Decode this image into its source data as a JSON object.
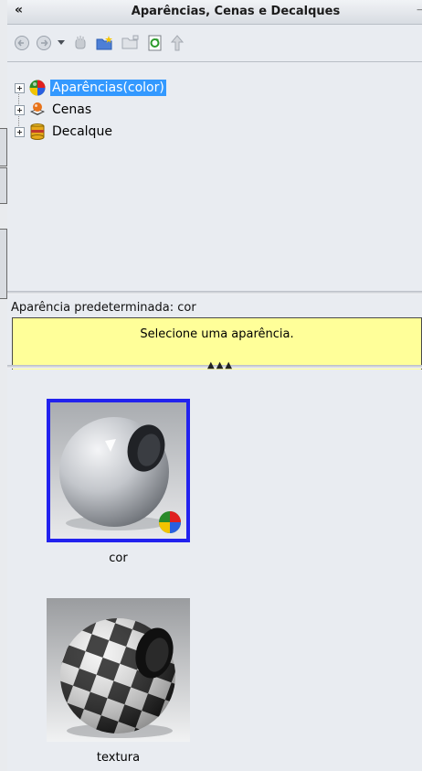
{
  "panel": {
    "title": "Aparências, Cenas e Decalques",
    "collapse_glyph": "«",
    "pin_glyph": "⊣"
  },
  "toolbar": {
    "buttons": [
      "back-icon",
      "forward-icon",
      "dropdown-arrow-icon",
      "hand-icon",
      "new-folder-icon",
      "folder-icon",
      "refresh-icon",
      "up-arrow-icon"
    ]
  },
  "tree": {
    "items": [
      {
        "label": "Aparências(color)",
        "icon": "appearances-icon",
        "selected": true
      },
      {
        "label": "Cenas",
        "icon": "scenes-icon",
        "selected": false
      },
      {
        "label": "Decalque",
        "icon": "decals-icon",
        "selected": false
      }
    ]
  },
  "preview": {
    "default_label": "Aparência predeterminada: cor",
    "hint": "Selecione uma aparência."
  },
  "gallery": {
    "items": [
      {
        "caption": "cor",
        "type": "color-sphere",
        "selected": true
      },
      {
        "caption": "textura",
        "type": "checker-sphere",
        "selected": false
      }
    ]
  },
  "colors": {
    "selection": "#3399ff",
    "thumb_border": "#2222ee",
    "hint_bg": "#ffff99"
  }
}
